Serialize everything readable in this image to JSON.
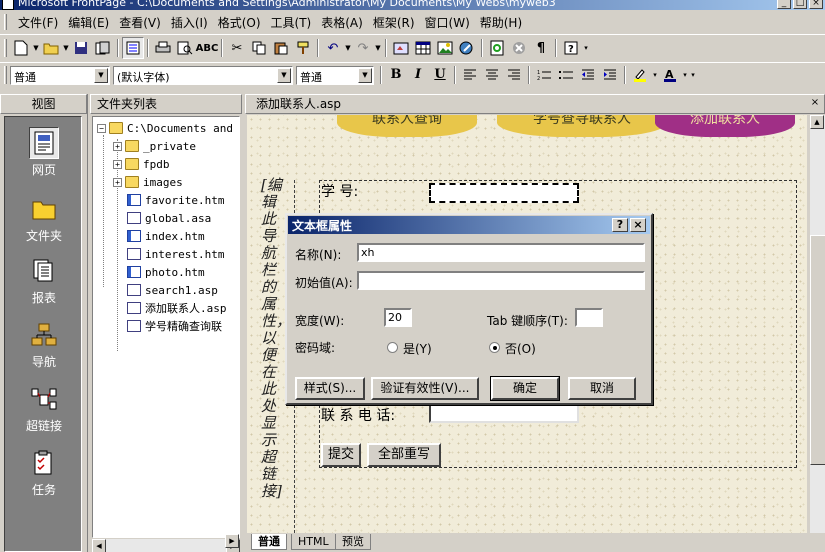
{
  "window": {
    "title": "Microsoft FrontPage - C:\\Documents and Settings\\Administrator\\My Documents\\My Webs\\myweb3",
    "controls": [
      "_",
      "□",
      "×"
    ]
  },
  "menubar": {
    "items": [
      "文件(F)",
      "编辑(E)",
      "查看(V)",
      "插入(I)",
      "格式(O)",
      "工具(T)",
      "表格(A)",
      "框架(R)",
      "窗口(W)",
      "帮助(H)"
    ]
  },
  "toolbar_format": {
    "style_value": "普通",
    "font_value": "(默认字体)",
    "size_value": "普通",
    "bold": "B",
    "italic": "I",
    "underline": "U"
  },
  "views_bar": {
    "header": "视图",
    "items": [
      {
        "label": "网页",
        "icon": "page-icon"
      },
      {
        "label": "文件夹",
        "icon": "folder-icon"
      },
      {
        "label": "报表",
        "icon": "reports-icon"
      },
      {
        "label": "导航",
        "icon": "navigation-icon"
      },
      {
        "label": "超链接",
        "icon": "hyperlinks-icon"
      },
      {
        "label": "任务",
        "icon": "tasks-icon"
      }
    ]
  },
  "folder_list": {
    "header": "文件夹列表",
    "root": "C:\\Documents and",
    "folders": [
      "_private",
      "fpdb",
      "images"
    ],
    "files": [
      "favorite.htm",
      "global.asa",
      "index.htm",
      "interest.htm",
      "photo.htm",
      "search1.asp",
      "添加联系人.asp",
      "学号精确查询联"
    ]
  },
  "editor": {
    "tab_title": "添加联系人.asp",
    "close": "×",
    "view_tabs": [
      "普通",
      "HTML",
      "预览"
    ]
  },
  "page_content": {
    "nav_links": [
      "联系人查询",
      "学号查寻联系人",
      "添加联系人"
    ],
    "side_text": "[编辑此导航栏的属性，以便在此处显示超链接]",
    "field_label_id": "学    号:",
    "field_label_phone": "联 系 电 话:",
    "submit": "提交",
    "reset": "全部重写"
  },
  "dialog": {
    "title": "文本框属性",
    "help": "?",
    "close": "×",
    "name_label": "名称(N):",
    "name_value": "xh",
    "initial_label": "初始值(A):",
    "initial_value": "",
    "width_label": "宽度(W):",
    "width_value": "20",
    "tab_order_label": "Tab 键顺序(T):",
    "tab_order_value": "",
    "password_label": "密码域:",
    "yes_label": "是(Y)",
    "no_label": "否(O)",
    "password_selected": "否(O)",
    "style_button": "样式(S)...",
    "validate_button": "验证有效性(V)...",
    "ok_button": "确定",
    "cancel_button": "取消"
  }
}
